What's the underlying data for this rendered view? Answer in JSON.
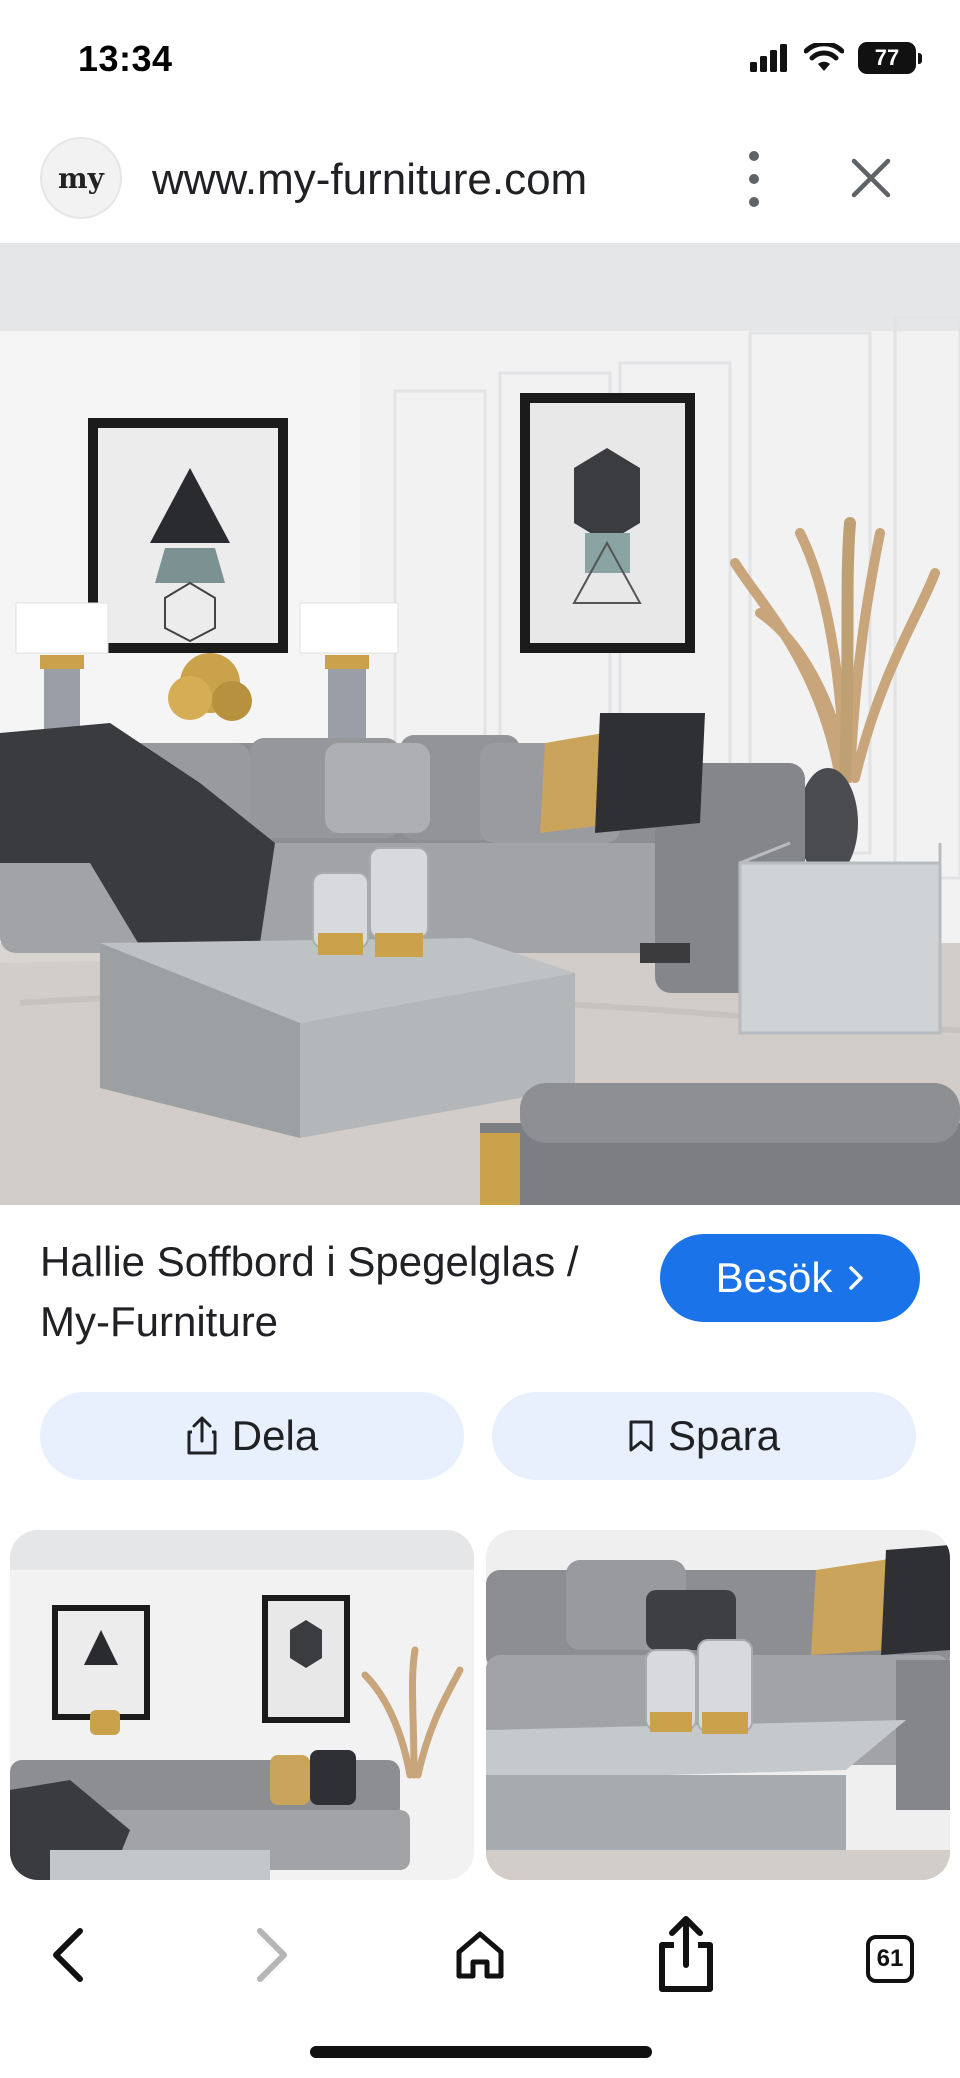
{
  "status_bar": {
    "time": "13:34",
    "battery": "77",
    "icons": [
      "cellular-signal-icon",
      "wifi-icon",
      "battery-icon"
    ]
  },
  "url_bar": {
    "logo_text": "my",
    "url": "www.my-furniture.com",
    "icons": [
      "more-options-icon",
      "close-icon"
    ]
  },
  "image_result": {
    "title": "Hallie Soffbord i Spegelglas / My-Furniture",
    "visit_label": "Besök",
    "share_label": "Dela",
    "save_label": "Spara"
  },
  "toolbar": {
    "tabs_count": "61",
    "icons": [
      "back-icon",
      "forward-icon",
      "home-icon",
      "share-icon",
      "tabs-icon"
    ]
  },
  "colors": {
    "accent": "#1a73e8",
    "action_bg": "#e8f0fe",
    "text": "#202124"
  }
}
